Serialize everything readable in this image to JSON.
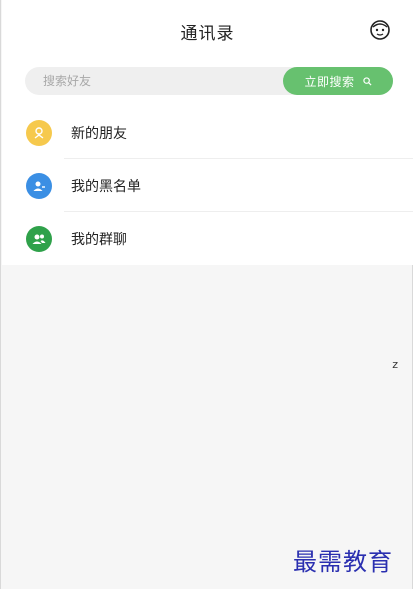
{
  "header": {
    "title": "通讯录",
    "icons": {
      "right": "face-icon"
    }
  },
  "search": {
    "placeholder": "搜索好友",
    "button_label": "立即搜索",
    "button_icon": "search-icon",
    "button_color": "#67c16f"
  },
  "menu": {
    "items": [
      {
        "label": "新的朋友",
        "icon": "new-friend-icon",
        "color": "#f6c94d"
      },
      {
        "label": "我的黑名单",
        "icon": "blacklist-icon",
        "color": "#3b8fe4"
      },
      {
        "label": "我的群聊",
        "icon": "group-chat-icon",
        "color": "#2fa14a"
      }
    ]
  },
  "index_bar": {
    "letter": "z"
  },
  "watermark": {
    "text": "最需教育"
  }
}
